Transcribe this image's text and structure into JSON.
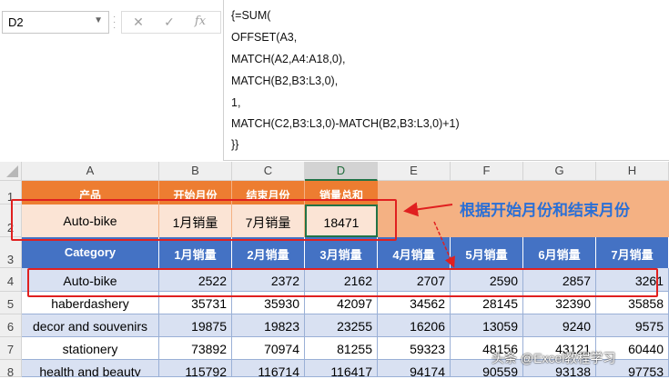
{
  "name_box": "D2",
  "fx_label": "fx",
  "formula_lines": [
    "{=SUM(",
    "OFFSET(A3,",
    "MATCH(A2,A4:A18,0),",
    "MATCH(B2,B3:L3,0),",
    "1,",
    "MATCH(C2,B3:L3,0)-MATCH(B2,B3:L3,0)+1)",
    "}}"
  ],
  "columns": [
    "A",
    "B",
    "C",
    "D",
    "E",
    "F",
    "G",
    "H"
  ],
  "rows": [
    "1",
    "2",
    "3",
    "4",
    "5",
    "6",
    "7",
    "8"
  ],
  "row1": [
    "产品",
    "开始月份",
    "结束月份",
    "销量总和"
  ],
  "row2": [
    "Auto-bike",
    "1月销量",
    "7月销量",
    "18471"
  ],
  "annotation": "根据开始月份和结束月份",
  "header": [
    "Category",
    "1月销量",
    "2月销量",
    "3月销量",
    "4月销量",
    "5月销量",
    "6月销量",
    "7月销量"
  ],
  "data_rows": [
    [
      "Auto-bike",
      "2522",
      "2372",
      "2162",
      "2707",
      "2590",
      "2857",
      "3261"
    ],
    [
      "haberdashery",
      "35731",
      "35930",
      "42097",
      "34562",
      "28145",
      "32390",
      "35858"
    ],
    [
      "decor and souvenirs",
      "19875",
      "19823",
      "23255",
      "16206",
      "13059",
      "9240",
      "9575"
    ],
    [
      "stationery",
      "73892",
      "70974",
      "81255",
      "59323",
      "48156",
      "43121",
      "60440"
    ],
    [
      "health and beauty",
      "115792",
      "116714",
      "116417",
      "94174",
      "90559",
      "93138",
      "97753"
    ]
  ],
  "watermark": "头条 @Excel教程学习",
  "colors": {
    "orange": "#ed7d31",
    "peach": "#fbe4d5",
    "blue": "#4472c4",
    "lightblue": "#d9e1f2",
    "red": "#e02020"
  }
}
